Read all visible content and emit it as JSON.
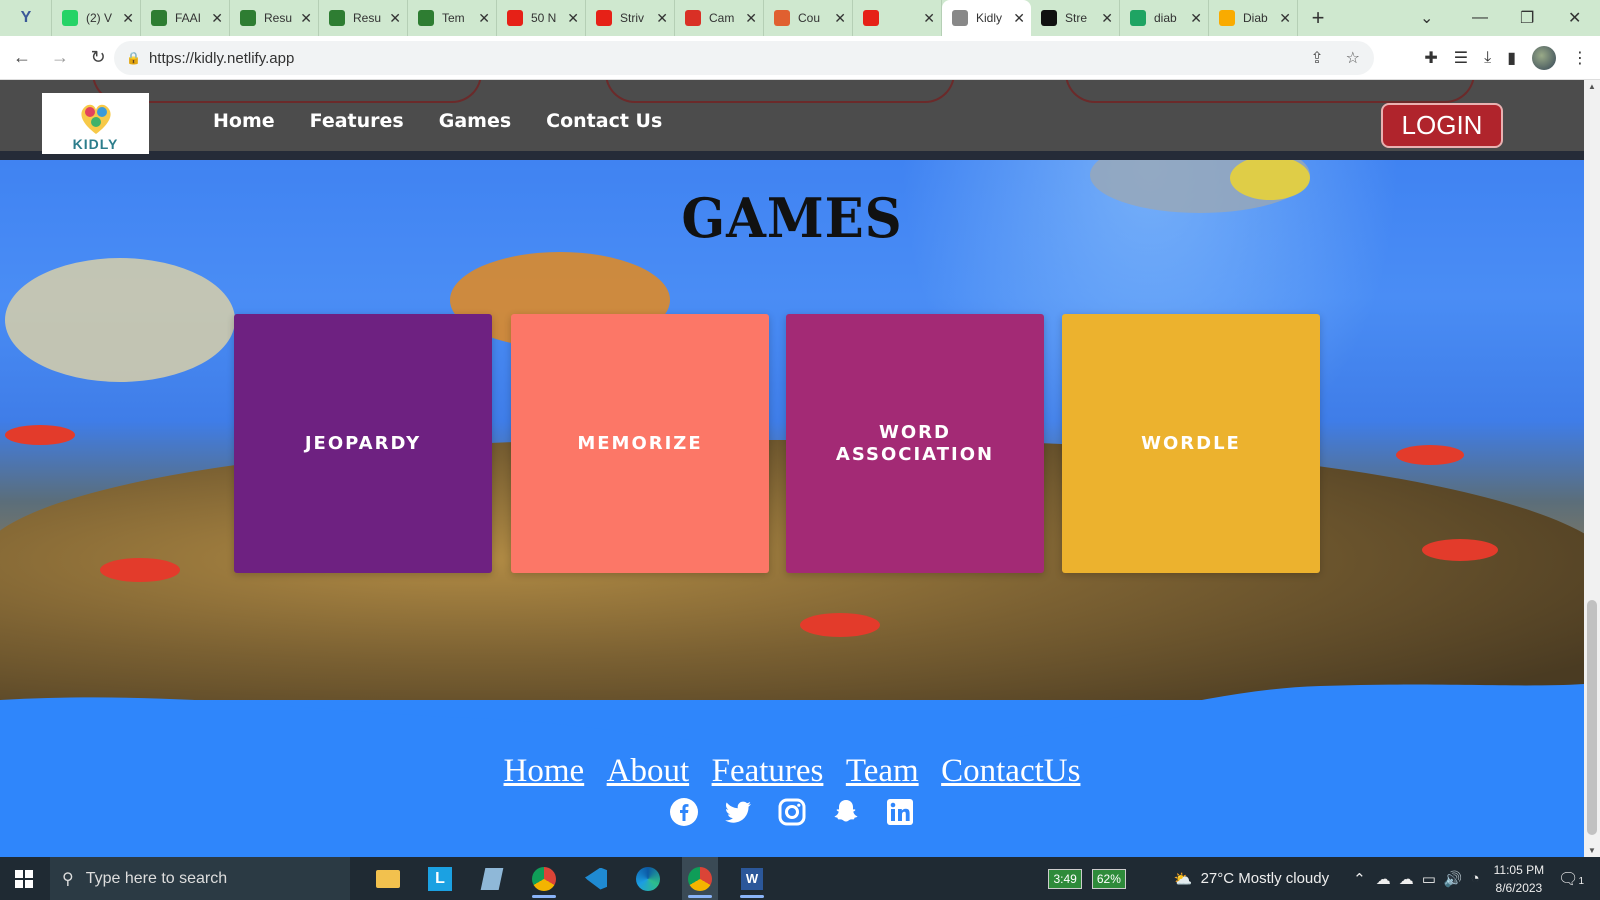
{
  "browser": {
    "tabs": [
      {
        "title": "",
        "icon": "yahoo-icon",
        "color": "#3b5998"
      },
      {
        "title": "(2) V",
        "icon": "whatsapp-icon",
        "color": "#25d366"
      },
      {
        "title": "FAAI",
        "icon": "leaf-icon",
        "color": "#2e7d32"
      },
      {
        "title": "Resu",
        "icon": "leaf-icon",
        "color": "#2e7d32"
      },
      {
        "title": "Resu",
        "icon": "leaf-icon",
        "color": "#2e7d32"
      },
      {
        "title": "Tem",
        "icon": "leaf-icon",
        "color": "#2e7d32"
      },
      {
        "title": "50 N",
        "icon": "youtube-icon",
        "color": "#e62117"
      },
      {
        "title": "Striv",
        "icon": "youtube-icon",
        "color": "#e62117"
      },
      {
        "title": "Cam",
        "icon": "gmail-icon",
        "color": "#d93025"
      },
      {
        "title": "Cou",
        "icon": "course-icon",
        "color": "#e06030"
      },
      {
        "title": "",
        "icon": "youtube-icon",
        "color": "#e62117"
      },
      {
        "title": "Kidly",
        "icon": "globe-icon",
        "color": "#888888"
      },
      {
        "title": "Stre",
        "icon": "stream-icon",
        "color": "#111111"
      },
      {
        "title": "diab",
        "icon": "drive-icon",
        "color": "#1fa463"
      },
      {
        "title": "Diab",
        "icon": "colab-icon",
        "color": "#f9ab00"
      }
    ],
    "active_tab_index": 11,
    "url": "https://kidly.netlify.app"
  },
  "site": {
    "logo_text": "KIDLY",
    "nav": [
      {
        "label": "Home"
      },
      {
        "label": "Features"
      },
      {
        "label": "Games"
      },
      {
        "label": "Contact Us"
      }
    ],
    "login_label": "LOGIN",
    "login_color": "#b0242c",
    "section_title": "GAMES",
    "games": [
      {
        "label_lines": [
          "JEOPARDY"
        ],
        "color": "#6e2181"
      },
      {
        "label_lines": [
          "MEMORIZE"
        ],
        "color": "#fc7767"
      },
      {
        "label_lines": [
          "WORD",
          "ASSOCIATION"
        ],
        "color": "#a32a75"
      },
      {
        "label_lines": [
          "WORDLE"
        ],
        "color": "#ecb22e"
      }
    ],
    "footer_links": [
      {
        "label": "Home"
      },
      {
        "label": "About"
      },
      {
        "label": "Features"
      },
      {
        "label": "Team"
      },
      {
        "label": "ContactUs"
      }
    ],
    "socials": [
      "facebook-icon",
      "twitter-icon",
      "instagram-icon",
      "snapchat-icon",
      "linkedin-icon"
    ],
    "background_color": "#2f86fb"
  },
  "taskbar": {
    "search_placeholder": "Type here to search",
    "battery_left": "3:49",
    "battery_percent": "62%",
    "weather": "27°C  Mostly cloudy",
    "time": "11:05 PM",
    "date": "8/6/2023",
    "notification_count": "1"
  }
}
